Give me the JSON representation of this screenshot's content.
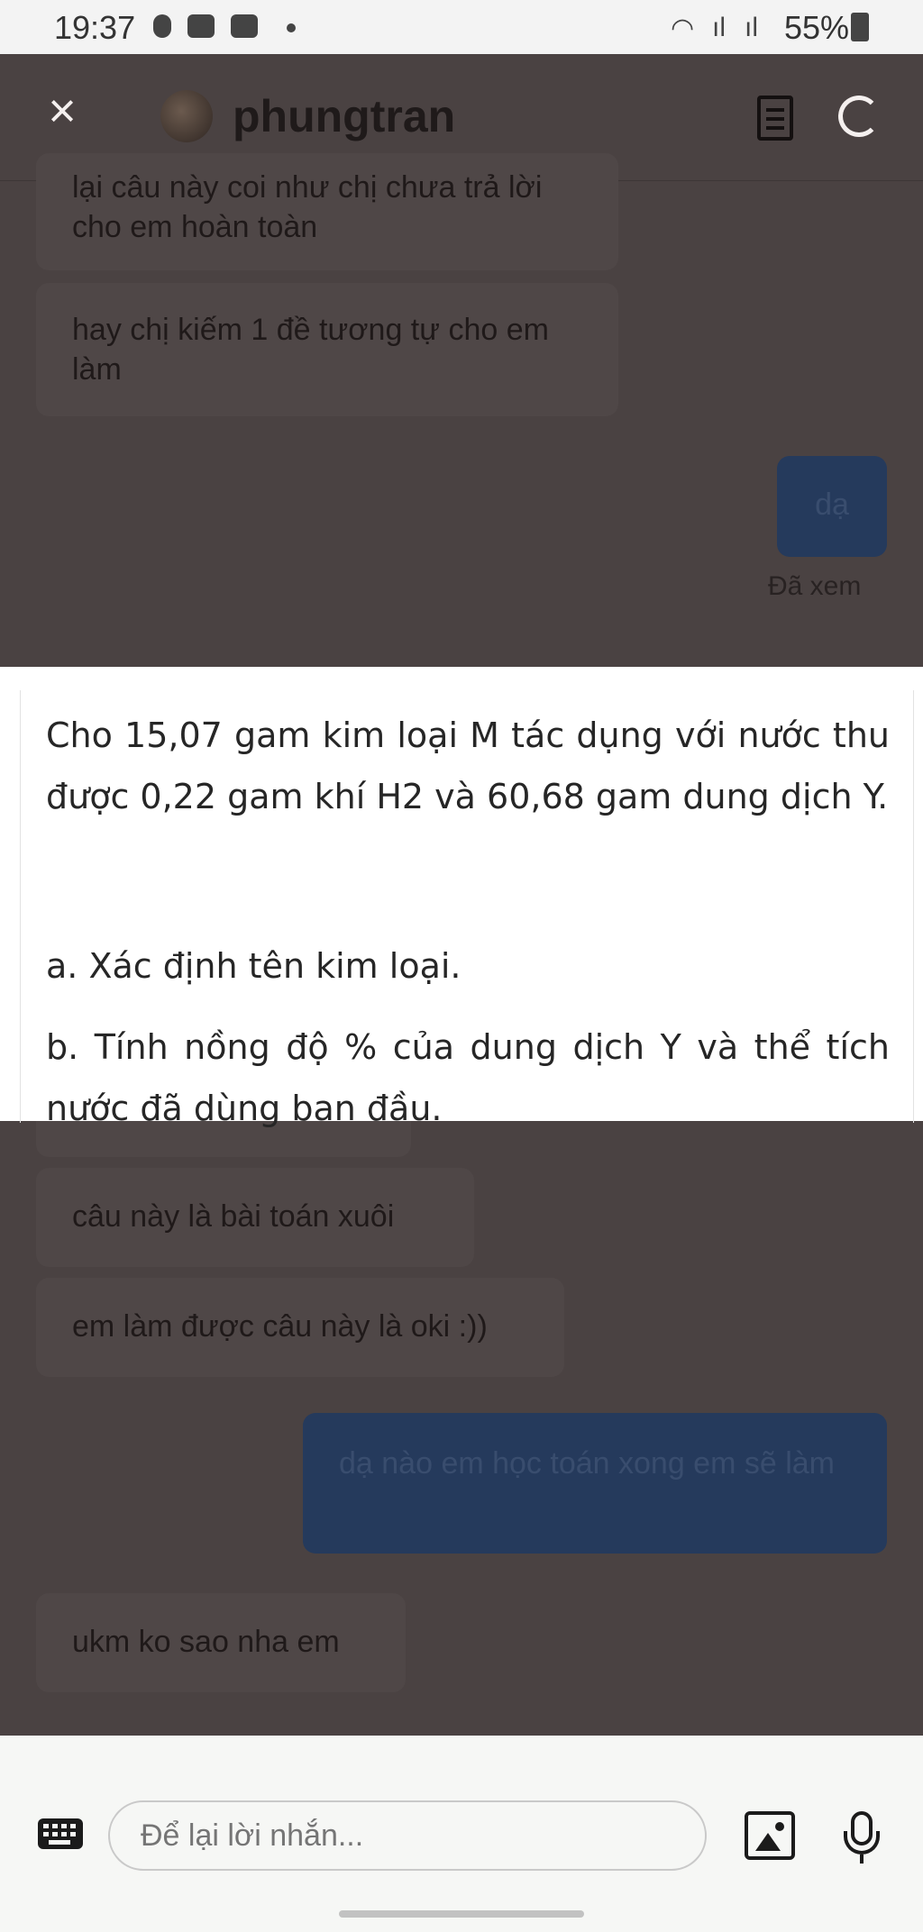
{
  "status_bar": {
    "time": "19:37",
    "battery": "55%"
  },
  "header": {
    "name": "phungtran"
  },
  "messages": {
    "m1": "lại câu này coi như chị chưa trả lời cho em hoàn toàn",
    "m2": "hay chị kiếm 1 đề tương tự cho em làm",
    "m3": "dạ",
    "seen": "Đã xem",
    "m4": "câu này là bài toán xuôi",
    "m5": "em làm được câu này là oki :))",
    "m6": "dạ nào em học toán xong em sẽ làm",
    "m7": "ukm ko sao nha em"
  },
  "question": {
    "text": "Cho 15,07 gam kim loại M tác dụng với nước thu được 0,22 gam khí H2 và 60,68 gam dung dịch Y.",
    "a": "a. Xác định tên kim loại.",
    "b": "b. Tính nồng độ % của dung dịch Y và thể tích nước đã dùng ban đầu."
  },
  "composer": {
    "placeholder": "Để lại lời nhắn..."
  },
  "icons": [
    "close-icon",
    "avatar",
    "document-icon",
    "refresh-icon",
    "keyboard-icon",
    "image-icon",
    "microphone-icon"
  ],
  "colors": {
    "chat_bg": "#4a4242",
    "bubble_received": "#4f4747",
    "bubble_sent": "#253a5c",
    "card_bg": "#ffffff",
    "composer_bg": "#f6f7f5"
  }
}
